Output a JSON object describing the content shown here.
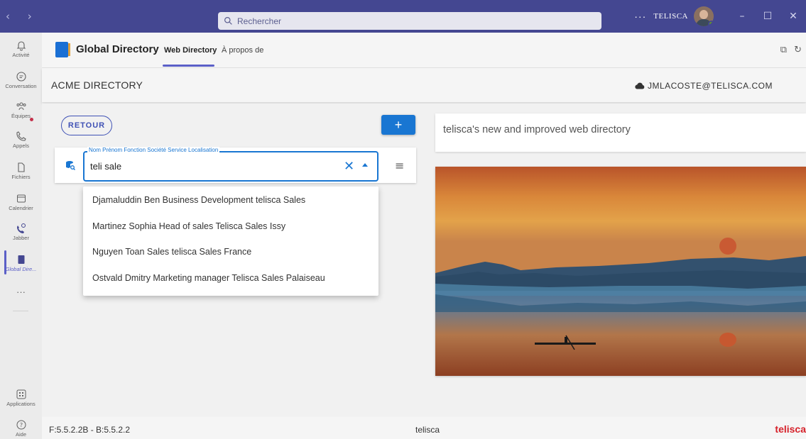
{
  "titlebar": {
    "nav": "‹ ›",
    "search_placeholder": "Rechercher",
    "more": "···",
    "org": "TELISCA",
    "minimize": "–",
    "maximize": "☐",
    "close": "✕"
  },
  "rail": {
    "items": [
      {
        "label": "Activité",
        "icon": "bell-icon"
      },
      {
        "label": "Conversation",
        "icon": "chat-icon"
      },
      {
        "label": "Équipes",
        "icon": "teams-icon"
      },
      {
        "label": "Appels",
        "icon": "phone-icon"
      },
      {
        "label": "Fichiers",
        "icon": "file-icon"
      },
      {
        "label": "Calendrier",
        "icon": "calendar-icon"
      },
      {
        "label": "Jabber",
        "icon": "jabber-icon"
      },
      {
        "label": "Global Dire...",
        "icon": "book-icon"
      },
      {
        "label": "Applications",
        "icon": "apps-icon"
      },
      {
        "label": "Aide",
        "icon": "help-icon"
      }
    ],
    "more": "···"
  },
  "app": {
    "title": "Global Directory",
    "tabs": [
      "Web Directory",
      "À propos de"
    ]
  },
  "directory": {
    "title": "ACME DIRECTORY",
    "user": "JMLACOSTE@TELISCA.COM",
    "back_label": "RETOUR",
    "add_label": "+",
    "field_label": "Nom Prénom Fonction Société Service Localisation",
    "field_value": "teli sale",
    "results": [
      "Djamaluddin Ben Business Development telisca Sales",
      "Martinez Sophia Head of sales Telisca Sales Issy",
      "Nguyen Toan Sales telisca Sales France",
      "Ostvald Dmitry Marketing manager Telisca Sales Palaiseau"
    ],
    "info_text": "telisca's new and improved web directory"
  },
  "footer": {
    "version": "F:5.5.2.2B - B:5.5.2.2",
    "center": "telisca",
    "brand": "telisca"
  },
  "colors": {
    "titlebar": "#444791",
    "accent": "#1976d2",
    "rail_active": "#5b5fc7",
    "brand": "#d6212a"
  }
}
